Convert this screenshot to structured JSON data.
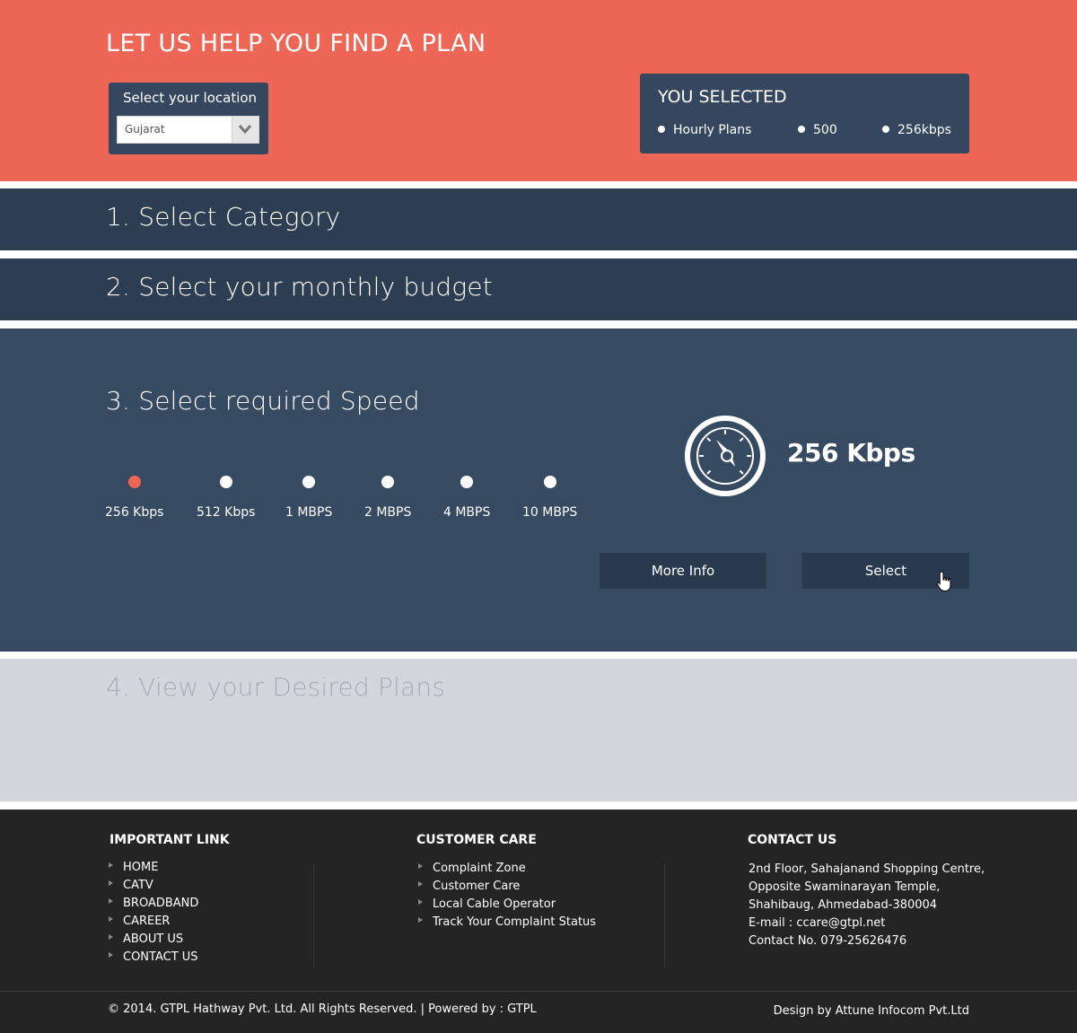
{
  "header": {
    "title": "LET US HELP YOU FIND A PLAN",
    "background_color": "#ee6656",
    "location": {
      "label": "Select your location",
      "selected": "Gujarat",
      "icon": "chevron-down-icon"
    },
    "you_selected": {
      "title": "YOU SELECTED",
      "items": [
        "Hourly Plans",
        "500",
        "256kbps"
      ]
    }
  },
  "steps": {
    "category": "1. Select Category",
    "budget": "2. Select your monthly budget",
    "speed": "3. Select required Speed",
    "plans": "4. View your Desired Plans"
  },
  "speed": {
    "options": [
      "256 Kbps",
      "512 Kbps",
      "1 MBPS",
      "2 MBPS",
      "4 MBPS",
      "10 MBPS"
    ],
    "selected_index": 0,
    "active_color": "#ee6656",
    "display_value": "256 Kbps",
    "gauge_icon": "speedometer-icon",
    "buttons": {
      "more_info": "More Info",
      "select": "Select"
    }
  },
  "footer": {
    "important_link": {
      "title": "IMPORTANT LINK",
      "items": [
        "HOME",
        "CATV",
        "BROADBAND",
        "CAREER",
        "ABOUT US",
        "CONTACT US"
      ]
    },
    "customer_care": {
      "title": "CUSTOMER CARE",
      "items": [
        "Complaint Zone",
        "Customer Care",
        "Local Cable Operator",
        "Track Your Complaint Status"
      ]
    },
    "contact_us": {
      "title": "CONTACT US",
      "address_line1": "2nd Floor, Sahajanand Shopping Centre,",
      "address_line2": "Opposite Swaminarayan Temple,",
      "address_line3": "Shahibaug, Ahmedabad-380004",
      "email": "E-mail :  ccare@gtpl.net",
      "phone": "Contact No. 079-25626476"
    },
    "copyright": "© 2014. GTPL Hathway Pvt. Ltd. All Rights Reserved. | Powered by : GTPL",
    "design_credit": "Design by Attune Infocom Pvt.Ltd"
  }
}
